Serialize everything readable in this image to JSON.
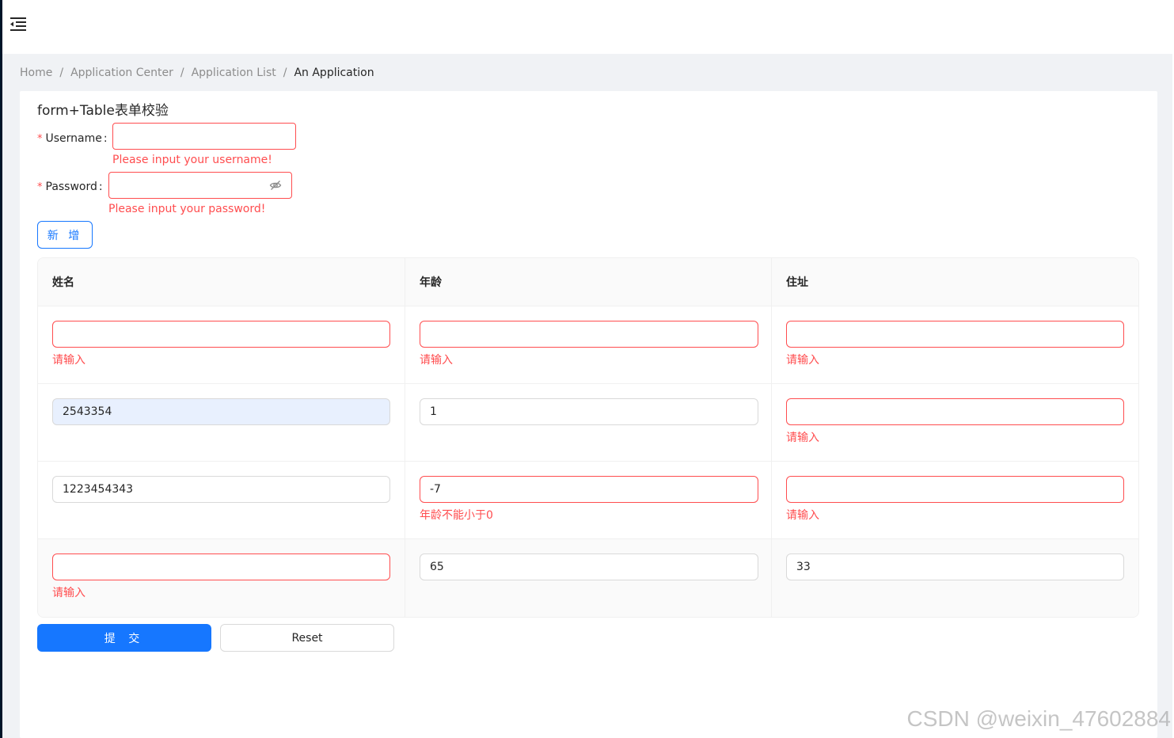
{
  "breadcrumb": [
    "Home",
    "Application Center",
    "Application List",
    "An Application"
  ],
  "card": {
    "title": "form+Table表单校验"
  },
  "form": {
    "username_label": "Username",
    "username_value": "",
    "username_error": "Please input your username!",
    "password_label": "Password",
    "password_value": "",
    "password_error": "Please input your password!",
    "required_mark": "*",
    "colon": ":"
  },
  "add_button": "新 增",
  "table": {
    "columns": [
      "姓名",
      "年龄",
      "住址"
    ],
    "rows": [
      {
        "name": "",
        "name_error": "请输入",
        "age": "",
        "age_error": "请输入",
        "address": "",
        "address_error": "请输入"
      },
      {
        "name": "2543354",
        "name_error": "",
        "age": "1",
        "age_error": "",
        "address": "",
        "address_error": "请输入"
      },
      {
        "name": "1223454343",
        "name_error": "",
        "age": "-7",
        "age_error": "年龄不能小于0",
        "address": "",
        "address_error": "请输入"
      },
      {
        "name": "",
        "name_error": "请输入",
        "age": "65",
        "age_error": "",
        "address": "33",
        "address_error": ""
      }
    ]
  },
  "actions": {
    "submit": "提 交",
    "reset": "Reset"
  },
  "watermark": "CSDN @weixin_47602884",
  "colors": {
    "primary": "#1677ff",
    "error": "#ff4d4f",
    "sider": "#001529"
  }
}
